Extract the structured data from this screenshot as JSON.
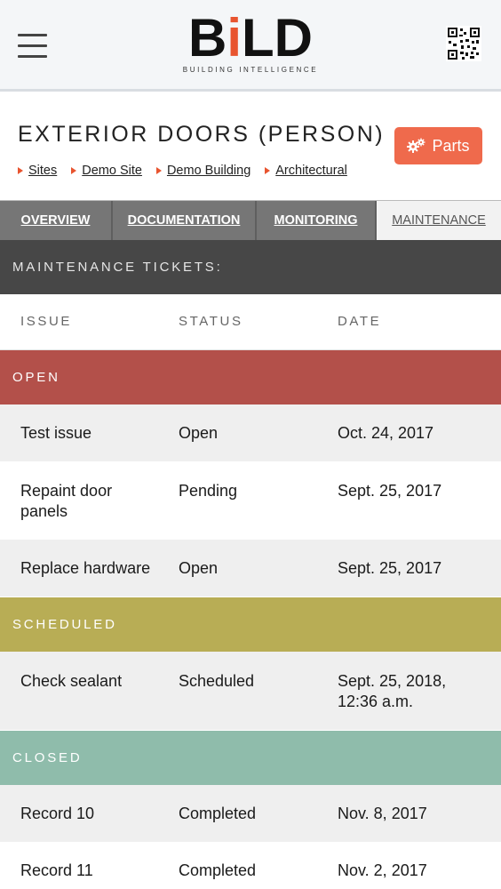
{
  "header": {
    "logo": {
      "main": "BiLD",
      "sub": "BUILDING  INTELLIGENCE",
      "accent_color": "#e8542f"
    },
    "menu_icon": "hamburger-icon",
    "qr_icon": "qr-code-icon"
  },
  "page": {
    "title": "EXTERIOR DOORS (PERSON)",
    "parts_label": "Parts",
    "parts_icon": "gears-icon",
    "parts_color": "#ef6a4c"
  },
  "breadcrumb": [
    "Sites",
    "Demo Site",
    "Demo Building",
    "Architectural"
  ],
  "tabs": [
    {
      "label": "OVERVIEW",
      "active": false
    },
    {
      "label": "DOCUMENTATION",
      "active": false
    },
    {
      "label": "MONITORING",
      "active": false
    },
    {
      "label": "MAINTENANCE",
      "active": true
    }
  ],
  "tickets": {
    "heading": "MAINTENANCE TICKETS:",
    "columns": [
      "ISSUE",
      "STATUS",
      "DATE"
    ],
    "groups": [
      {
        "label": "OPEN",
        "color": "#b3504a",
        "rows": [
          {
            "issue": "Test issue",
            "status": "Open",
            "date": "Oct. 24, 2017"
          },
          {
            "issue": "Repaint door panels",
            "status": "Pending",
            "date": "Sept. 25, 2017"
          },
          {
            "issue": "Replace hardware",
            "status": "Open",
            "date": "Sept. 25, 2017"
          }
        ]
      },
      {
        "label": "SCHEDULED",
        "color": "#b8ad55",
        "rows": [
          {
            "issue": "Check sealant",
            "status": "Scheduled",
            "date": "Sept. 25, 2018, 12:36 a.m."
          }
        ]
      },
      {
        "label": "CLOSED",
        "color": "#8fbcab",
        "rows": [
          {
            "issue": "Record 10",
            "status": "Completed",
            "date": "Nov. 8, 2017"
          },
          {
            "issue": "Record 11",
            "status": "Completed",
            "date": "Nov. 2, 2017"
          }
        ]
      }
    ]
  }
}
